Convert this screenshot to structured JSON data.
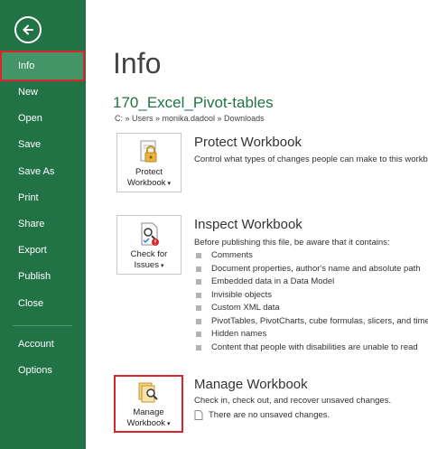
{
  "sidebar": {
    "items": [
      {
        "label": "Info"
      },
      {
        "label": "New"
      },
      {
        "label": "Open"
      },
      {
        "label": "Save"
      },
      {
        "label": "Save As"
      },
      {
        "label": "Print"
      },
      {
        "label": "Share"
      },
      {
        "label": "Export"
      },
      {
        "label": "Publish"
      },
      {
        "label": "Close"
      },
      {
        "label": "Account"
      },
      {
        "label": "Options"
      }
    ],
    "active": "Info",
    "back_icon": "back-arrow-icon"
  },
  "main": {
    "title": "Info",
    "filename": "170_Excel_Pivot-tables",
    "path": "C: » Users » monika.dadool » Downloads",
    "protect": {
      "button_line1": "Protect",
      "button_line2": "Workbook",
      "title": "Protect Workbook",
      "description": "Control what types of changes people can make to this workbook"
    },
    "inspect": {
      "button_line1": "Check for",
      "button_line2": "Issues",
      "title": "Inspect Workbook",
      "description": "Before publishing this file, be aware that it contains:",
      "items": [
        "Comments",
        "Document properties, author's name and absolute path",
        "Embedded data in a Data Model",
        "Invisible objects",
        "Custom XML data",
        "PivotTables, PivotCharts, cube formulas, slicers, and timelines",
        "Hidden names",
        "Content that people with disabilities are unable to read"
      ]
    },
    "manage": {
      "button_line1": "Manage",
      "button_line2": "Workbook",
      "title": "Manage Workbook",
      "description": "Check in, check out, and recover unsaved changes.",
      "note": "There are no unsaved changes."
    }
  },
  "colors": {
    "brand_green": "#217346",
    "active_item": "#439467",
    "highlight_red": "#d8262a"
  }
}
